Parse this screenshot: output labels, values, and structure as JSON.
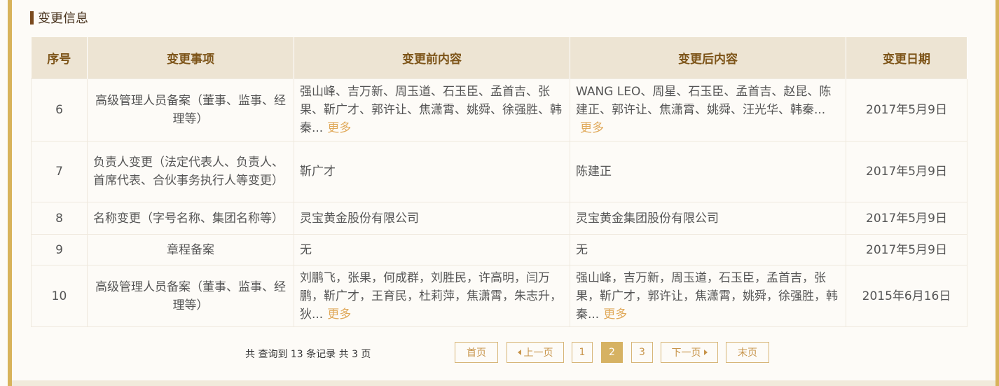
{
  "section": {
    "title": "变更信息"
  },
  "table": {
    "headers": [
      "序号",
      "变更事项",
      "变更前内容",
      "变更后内容",
      "变更日期"
    ],
    "rows": [
      {
        "no": "6",
        "item": "高级管理人员备案（董事、监事、经理等）",
        "before": "强山峰、吉万新、周玉道、石玉臣、孟首吉、张果、靳广才、郭许让、焦潇霄、姚舜、徐强胜、韩秦...",
        "before_more": "更多",
        "after": "WANG LEO、周星、石玉臣、孟首吉、赵昆、陈建正、郭许让、焦潇霄、姚舜、汪光华、韩秦...",
        "after_more": "更多",
        "date": "2017年5月9日"
      },
      {
        "no": "7",
        "item": "负责人变更（法定代表人、负责人、首席代表、合伙事务执行人等变更）",
        "before": "靳广才",
        "before_more": "",
        "after": "陈建正",
        "after_more": "",
        "date": "2017年5月9日"
      },
      {
        "no": "8",
        "item": "名称变更（字号名称、集团名称等）",
        "before": "灵宝黄金股份有限公司",
        "before_more": "",
        "after": "灵宝黄金集团股份有限公司",
        "after_more": "",
        "date": "2017年5月9日"
      },
      {
        "no": "9",
        "item": "章程备案",
        "before": "无",
        "before_more": "",
        "after": "无",
        "after_more": "",
        "date": "2017年5月9日"
      },
      {
        "no": "10",
        "item": "高级管理人员备案（董事、监事、经理等）",
        "before": "刘鹏飞，张果，何成群，刘胜民，许高明，闫万鹏，靳广才，王育民，杜莉萍，焦潇霄，朱志升，狄...",
        "before_more": "更多",
        "after": "强山峰，吉万新，周玉道，石玉臣，孟首吉，张果，靳广才，郭许让，焦潇霄，姚舜，徐强胜，韩秦...",
        "after_more": "更多",
        "date": "2015年6月16日"
      }
    ]
  },
  "pager": {
    "summary": "共 查询到 13 条记录 共 3 页",
    "first": "首页",
    "prev": "上一页",
    "pages": [
      "1",
      "2",
      "3"
    ],
    "current": "2",
    "next": "下一页",
    "last": "末页"
  },
  "colors": {
    "accent": "#d6b263",
    "header_bg": "#ede4d3",
    "header_text": "#7d5418",
    "link": "#e0a95a",
    "border_frame": "#d8b35b"
  }
}
